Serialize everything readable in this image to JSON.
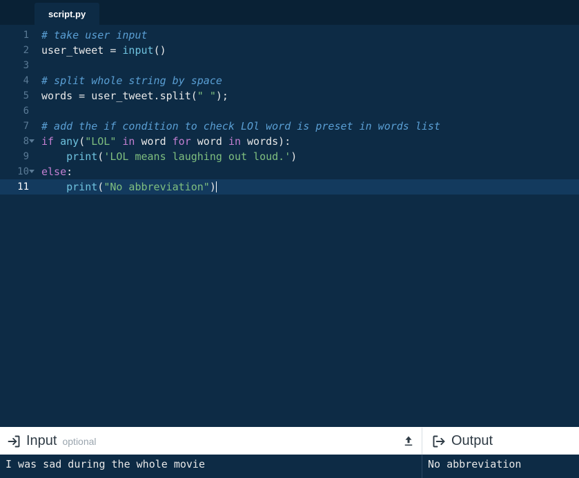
{
  "tab": {
    "filename": "script.py"
  },
  "gutter": [
    "1",
    "2",
    "3",
    "4",
    "5",
    "6",
    "7",
    "8",
    "9",
    "10",
    "11"
  ],
  "code": {
    "l1_comment": "# take user input",
    "l2_ident1": "user_tweet",
    "l2_op": " = ",
    "l2_builtin": "input",
    "l2_paren": "()",
    "l4_comment": "# split whole string by space",
    "l5_ident1": "words",
    "l5_op": " = ",
    "l5_ident2": "user_tweet.split(",
    "l5_str": "\" \"",
    "l5_close": ");",
    "l7_comment": "# add the if condition to check LOl word is preset in words list",
    "l8_if": "if",
    "l8_sp1": " ",
    "l8_any": "any",
    "l8_open": "(",
    "l8_str": "\"LOL\"",
    "l8_sp2": " ",
    "l8_in1": "in",
    "l8_sp3": " ",
    "l8_word": "word",
    "l8_sp4": " ",
    "l8_for": "for",
    "l8_sp5": " ",
    "l8_word2": "word",
    "l8_sp6": " ",
    "l8_in2": "in",
    "l8_sp7": " ",
    "l8_words": "words):",
    "l9_indent": "    ",
    "l9_print": "print",
    "l9_open": "(",
    "l9_str": "'LOL means laughing out loud.'",
    "l9_close": ")",
    "l10_else": "else",
    "l10_colon": ":",
    "l11_indent": "    ",
    "l11_print": "print",
    "l11_open": "(",
    "l11_str": "\"No abbreviation\"",
    "l11_close": ")"
  },
  "io": {
    "input_label": "Input",
    "input_optional": "optional",
    "output_label": "Output",
    "input_value": "I was sad during the whole movie",
    "output_value": "No abbreviation"
  }
}
